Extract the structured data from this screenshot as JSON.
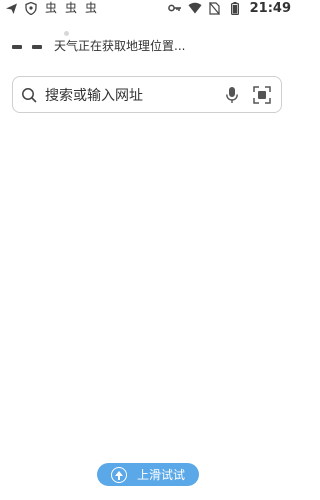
{
  "status_bar": {
    "time": "21:49",
    "left_icons": [
      "send-icon",
      "shield-icon",
      "bug-icon",
      "bug-icon",
      "bug-icon"
    ],
    "right_icons": [
      "key-icon",
      "wifi-icon",
      "no-sim-icon",
      "battery-icon"
    ],
    "bug_glyph": "虫"
  },
  "weather": {
    "text": "天气正在获取地理位置..."
  },
  "search": {
    "placeholder": "搜索或输入网址"
  },
  "bottom_bar": {
    "label": "上滑试试"
  },
  "colors": {
    "accent": "#5aa8e8",
    "search_border": "#cfcfcf",
    "text": "#333333"
  }
}
